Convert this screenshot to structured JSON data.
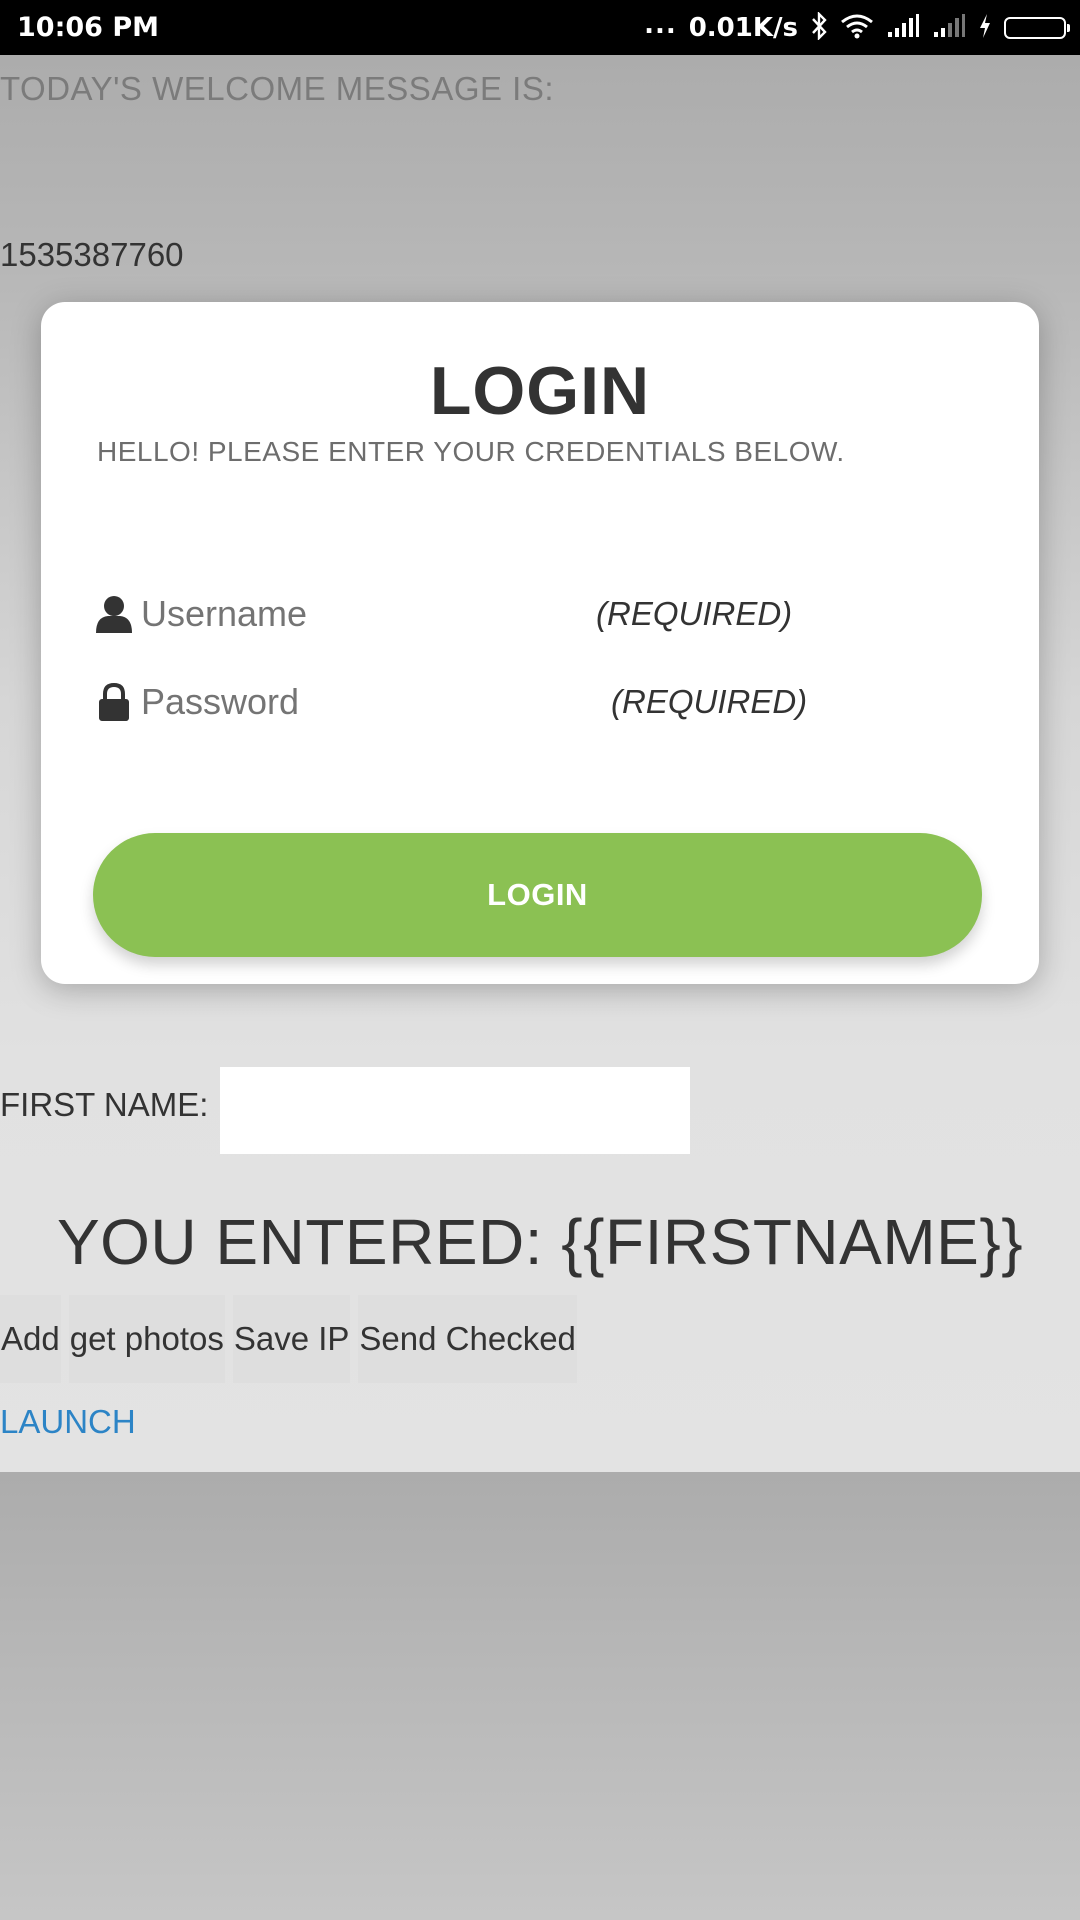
{
  "status_bar": {
    "time": "10:06 PM",
    "dots": "...",
    "speed": "0.01K/s",
    "icons": [
      "bluetooth-icon",
      "wifi-icon",
      "signal-icon",
      "signal-weak-icon",
      "charging-icon",
      "battery-icon"
    ],
    "battery_color": "#5ed02a"
  },
  "welcome": {
    "label": "TODAY'S WELCOME MESSAGE IS:",
    "timestamp": "1535387760"
  },
  "login": {
    "title": "LOGIN",
    "subtitle": "HELLO! PLEASE ENTER YOUR CREDENTIALS BELOW.",
    "username_placeholder": "Username",
    "username_required": "(REQUIRED)",
    "password_placeholder": "Password",
    "password_required": "(REQUIRED)",
    "button_label": "LOGIN",
    "button_color": "#8bc153"
  },
  "form": {
    "first_name_label": "FIRST NAME:",
    "first_name_value": "",
    "you_entered": "YOU ENTERED: {{FIRSTNAME}}"
  },
  "buttons": [
    "Add",
    "get photos",
    "Save IP",
    "Send Checked"
  ],
  "launch_link": "LAUNCH",
  "colors": {
    "accent_link": "#2c84c6",
    "text_dark": "#333333"
  }
}
